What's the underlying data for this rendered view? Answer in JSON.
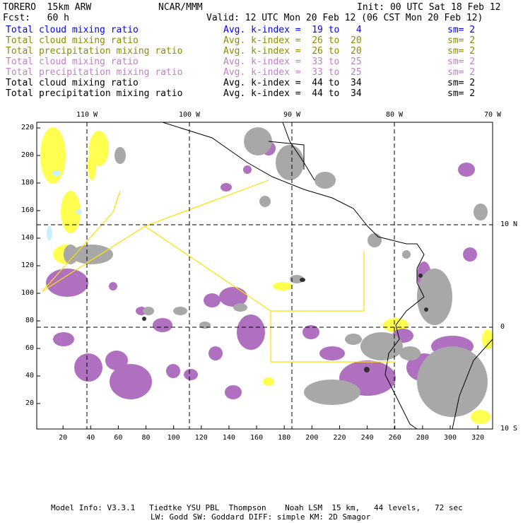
{
  "header": {
    "model": "TORERO  15km ARW",
    "org": "NCAR/MMM",
    "init": "Init: 00 UTC Sat 18 Feb 12",
    "fcst": "Fcst:   60 h",
    "valid": "Valid: 12 UTC Mon 20 Feb 12 (06 CST Mon 20 Feb 12)"
  },
  "legend": [
    {
      "field": "Total cloud mixing ratio",
      "range": "Avg. k-index =  19 to   4",
      "sm": "sm= 2",
      "color": "#0000ff"
    },
    {
      "field": "Total cloud mixing ratio",
      "range": "Avg. k-index =  26 to  20",
      "sm": "sm= 2",
      "color": "#8c8c00"
    },
    {
      "field": "Total precipitation mixing ratio",
      "range": "Avg. k-index =  26 to  20",
      "sm": "sm= 2",
      "color": "#8c8c00"
    },
    {
      "field": "Total cloud mixing ratio",
      "range": "Avg. k-index =  33 to  25",
      "sm": "sm= 2",
      "color": "#c080c8"
    },
    {
      "field": "Total precipitation mixing ratio",
      "range": "Avg. k-index =  33 to  25",
      "sm": "sm= 2",
      "color": "#c080c8"
    },
    {
      "field": "Total cloud mixing ratio",
      "range": "Avg. k-index =  44 to  34",
      "sm": "sm= 2",
      "color": "#000000"
    },
    {
      "field": "Total precipitation mixing ratio",
      "range": "Avg. k-index =  44 to  34",
      "sm": "sm= 2",
      "color": "#000000"
    }
  ],
  "axes": {
    "x_ticks": [
      "20",
      "40",
      "60",
      "80",
      "100",
      "120",
      "140",
      "160",
      "180",
      "200",
      "220",
      "240",
      "260",
      "280",
      "300",
      "320"
    ],
    "y_ticks": [
      "20",
      "40",
      "60",
      "80",
      "100",
      "120",
      "140",
      "160",
      "180",
      "200",
      "220"
    ],
    "lon_labels": [
      "110 W",
      "100 W",
      "90 W",
      "80 W",
      "70 W"
    ],
    "lat_labels": [
      "10 N",
      "0",
      "10 S"
    ]
  },
  "colors": {
    "gray": "#a8a8a8",
    "purple": "#b070c0",
    "yellow": "#ffff50",
    "cyan": "#c8f0ff",
    "outline": "#ffe000"
  },
  "footer": {
    "line1": "Model Info: V3.3.1   Tiedtke YSU PBL  Thompson    Noah LSM  15 km,   44 levels,   72 sec",
    "line2": "LW: Godd SW: Goddard DIFF: simple KM: 2D Smagor"
  }
}
